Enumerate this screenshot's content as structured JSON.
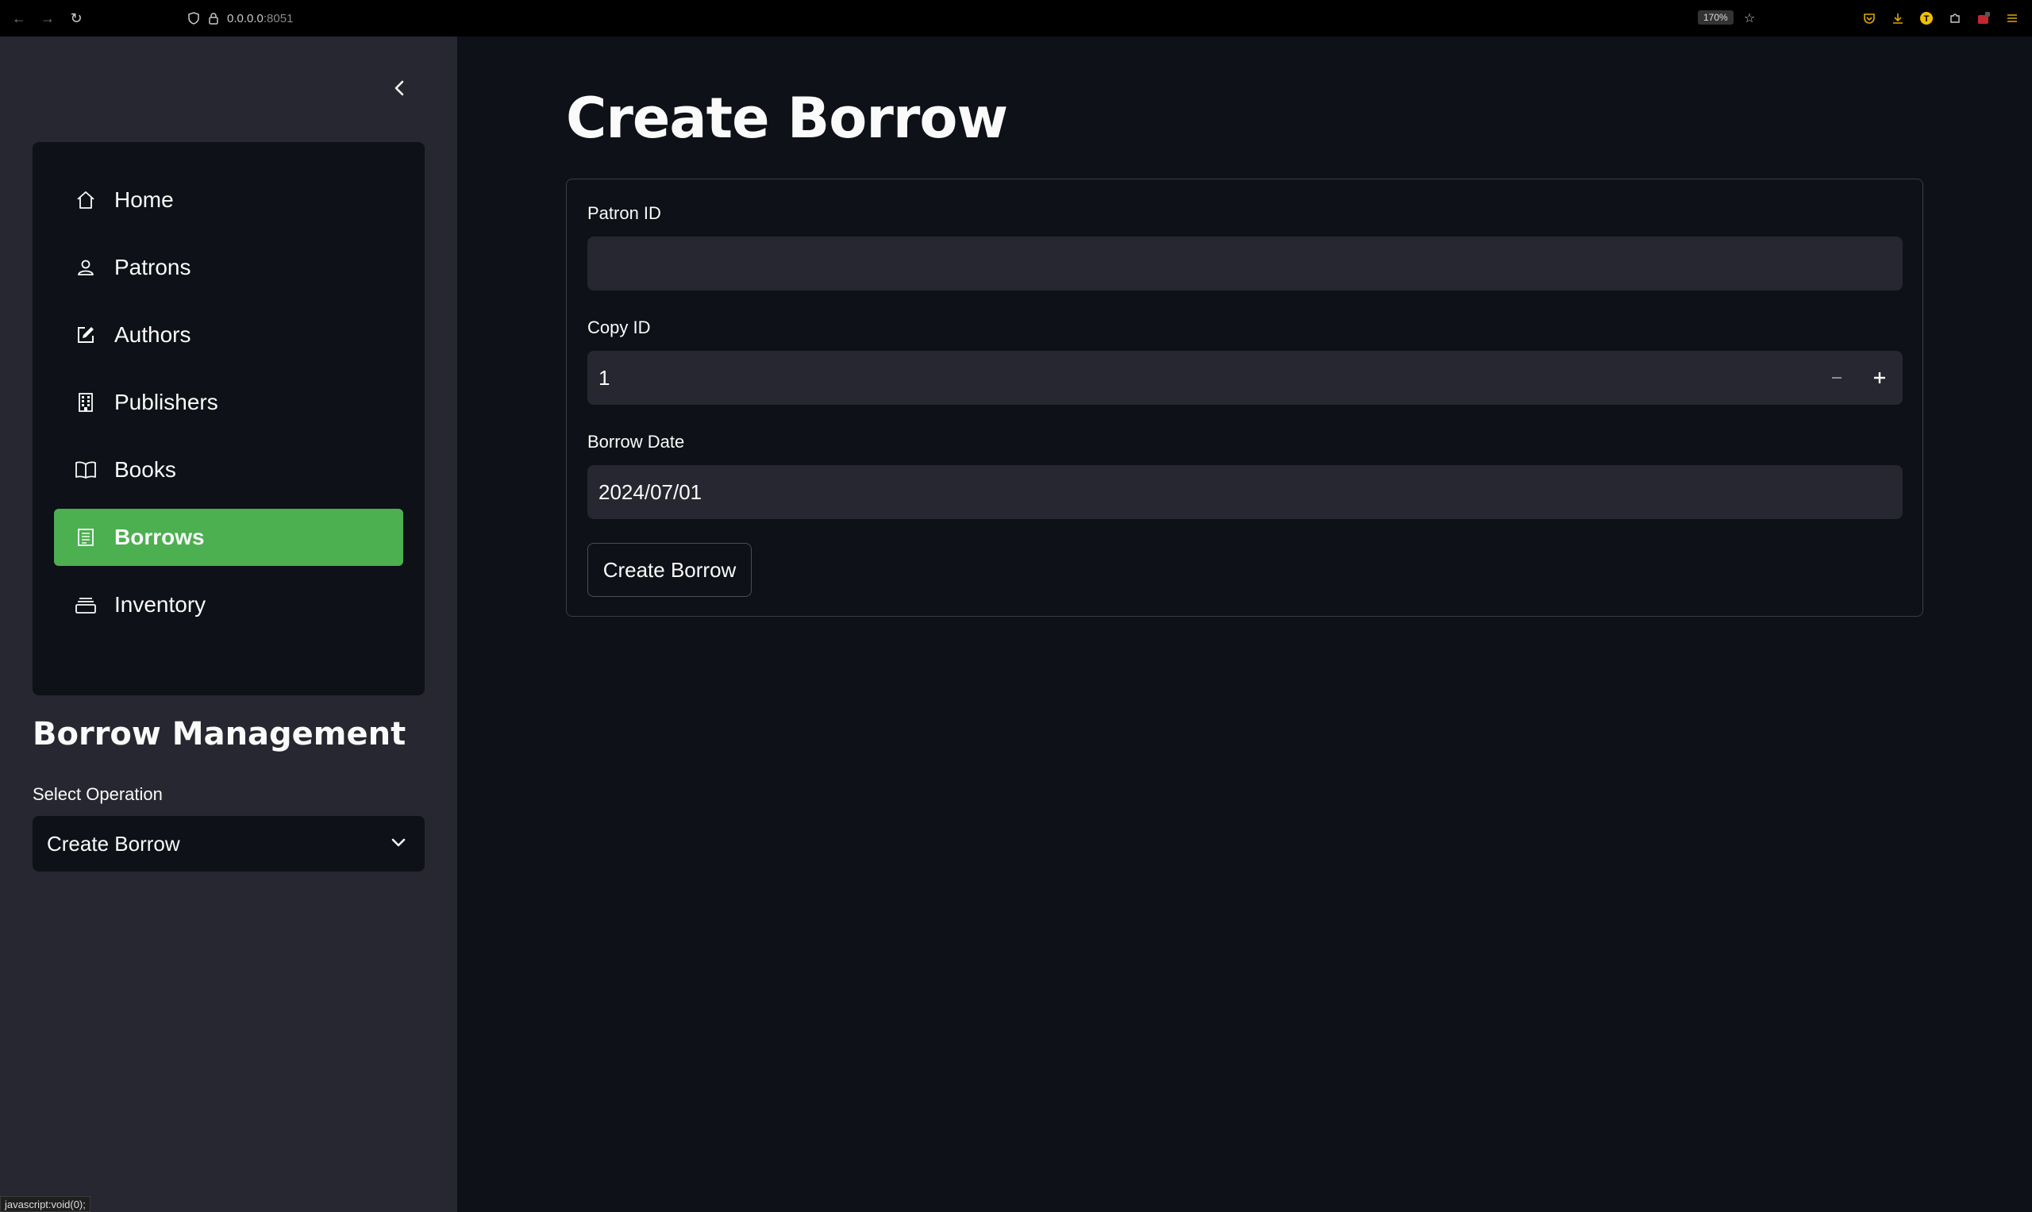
{
  "browser": {
    "url_host": "0.0.0.0",
    "url_port": ":8051",
    "zoom": "170%"
  },
  "sidebar": {
    "nav_items": [
      {
        "label": "Home",
        "icon": "home-icon"
      },
      {
        "label": "Patrons",
        "icon": "person-icon"
      },
      {
        "label": "Authors",
        "icon": "pencil-square-icon"
      },
      {
        "label": "Publishers",
        "icon": "building-icon"
      },
      {
        "label": "Books",
        "icon": "book-icon"
      },
      {
        "label": "Borrows",
        "icon": "receipt-icon",
        "active": true
      },
      {
        "label": "Inventory",
        "icon": "stack-icon"
      }
    ],
    "section_title": "Borrow Management",
    "select_label": "Select Operation",
    "select_value": "Create Borrow",
    "status_tip": "javascript:void(0);"
  },
  "main": {
    "title": "Create Borrow",
    "form": {
      "patron_label": "Patron ID",
      "patron_value": "",
      "copy_label": "Copy ID",
      "copy_value": "1",
      "date_label": "Borrow Date",
      "date_value": "2024/07/01",
      "submit_label": "Create Borrow"
    }
  },
  "colors": {
    "accent": "#4caf50",
    "background": "#0e1117",
    "sidebar": "#262730"
  }
}
